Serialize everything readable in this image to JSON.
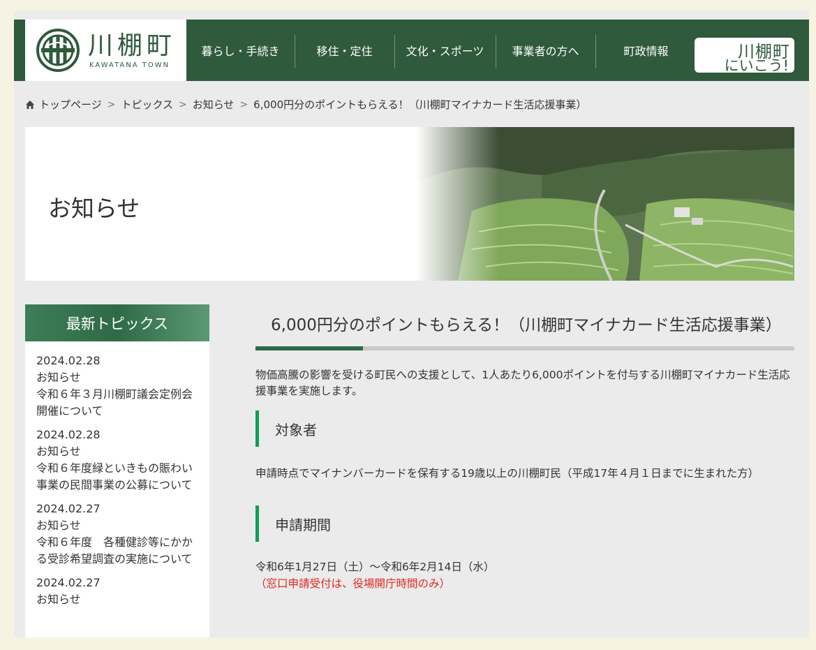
{
  "header": {
    "logo_jp": "川棚町",
    "logo_en": "KAWATANA TOWN",
    "nav": [
      "暮らし・手続き",
      "移住・定住",
      "文化・スポーツ",
      "事業者の方へ",
      "町政情報"
    ],
    "cta_line1": "川棚町",
    "cta_line2": "にいこう!"
  },
  "breadcrumb": {
    "items": [
      "トップページ",
      "トピックス",
      "お知らせ",
      "6,000円分のポイントもらえる！（川棚町マイナカード生活応援事業）"
    ],
    "separator": ">"
  },
  "hero": {
    "title": "お知らせ"
  },
  "sidebar": {
    "heading": "最新トピックス",
    "topics": [
      {
        "date": "2024.02.28",
        "category": "お知らせ",
        "title": "令和６年３月川棚町議会定例会開催について"
      },
      {
        "date": "2024.02.28",
        "category": "お知らせ",
        "title": "令和６年度緑といきもの賑わい事業の民間事業の公募について"
      },
      {
        "date": "2024.02.27",
        "category": "お知らせ",
        "title": "令和６年度　各種健診等にかかる受診希望調査の実施について"
      },
      {
        "date": "2024.02.27",
        "category": "お知らせ",
        "title": ""
      }
    ]
  },
  "article": {
    "title": "6,000円分のポイントもらえる！（川棚町マイナカード生活応援事業）",
    "intro": "物価高騰の影響を受ける町民への支援として、1人あたり6,000ポイントを付与する川棚町マイナカード生活応援事業を実施します。",
    "sections": [
      {
        "heading": "対象者",
        "text": "申請時点でマイナンバーカードを保有する19歳以上の川棚町民（平成17年４月１日までに生まれた方）"
      },
      {
        "heading": "申請期間",
        "text": "令和6年1月27日（土）～令和6年2月14日（水）",
        "note": "（窓口申請受付は、役場開庁時間のみ）"
      }
    ]
  },
  "colors": {
    "brand_green": "#2f5a3b",
    "accent_green": "#119e54",
    "note_red": "#e0281c"
  }
}
